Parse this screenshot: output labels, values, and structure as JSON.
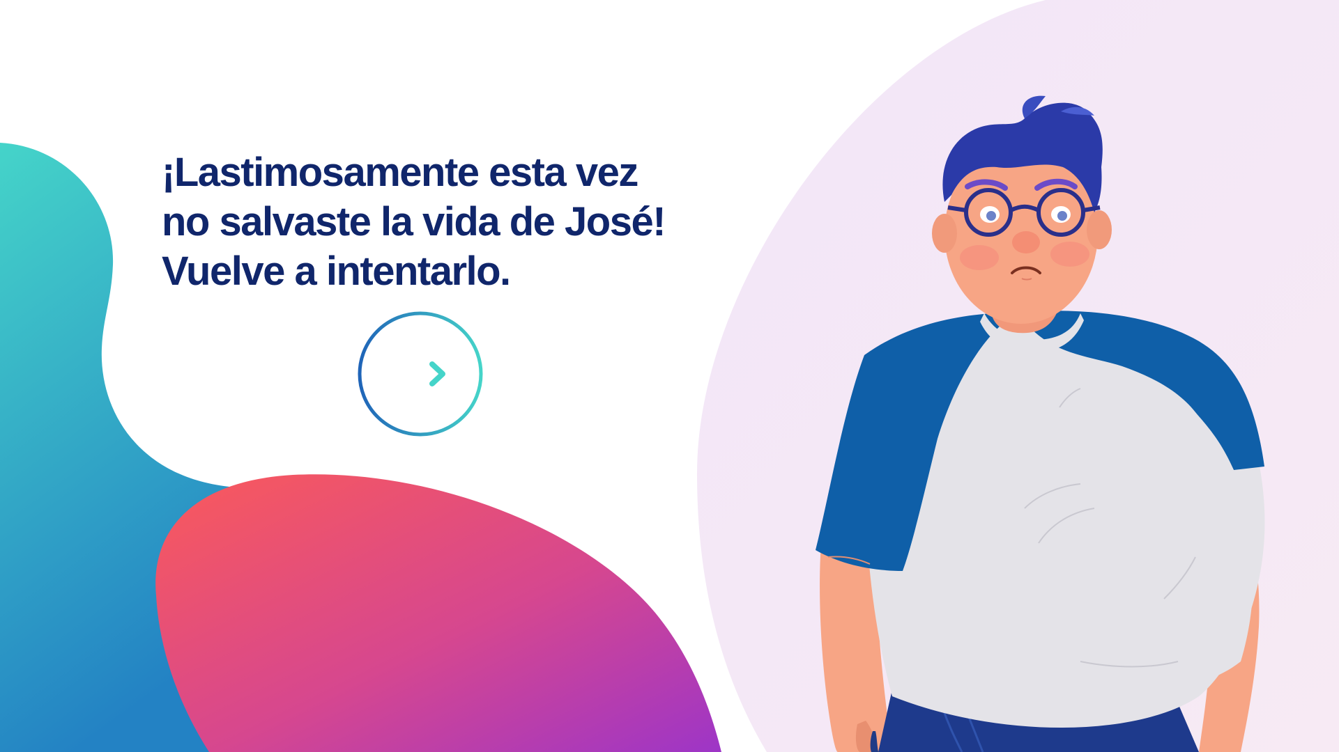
{
  "message": {
    "line1": "¡Lastimosamente esta vez",
    "line2": "no salvaste la vida de José!",
    "line3": "Vuelve a intentarlo."
  },
  "next_button": {
    "icon": "arrow-right-icon",
    "aria_label": "Vuelve a intentarlo"
  },
  "colors": {
    "text": "#10266b",
    "teal": "#3fd3c6",
    "blue": "#1f64b8",
    "coral": "#f45a5f",
    "purple": "#a63cc4",
    "lavender": "#f3e8f8",
    "shirt_blue": "#0f5fa8",
    "shirt_grey": "#e4e3e8",
    "skin": "#f7a585",
    "hair": "#2b3aa8"
  },
  "character": {
    "name": "José",
    "mood": "sad"
  }
}
